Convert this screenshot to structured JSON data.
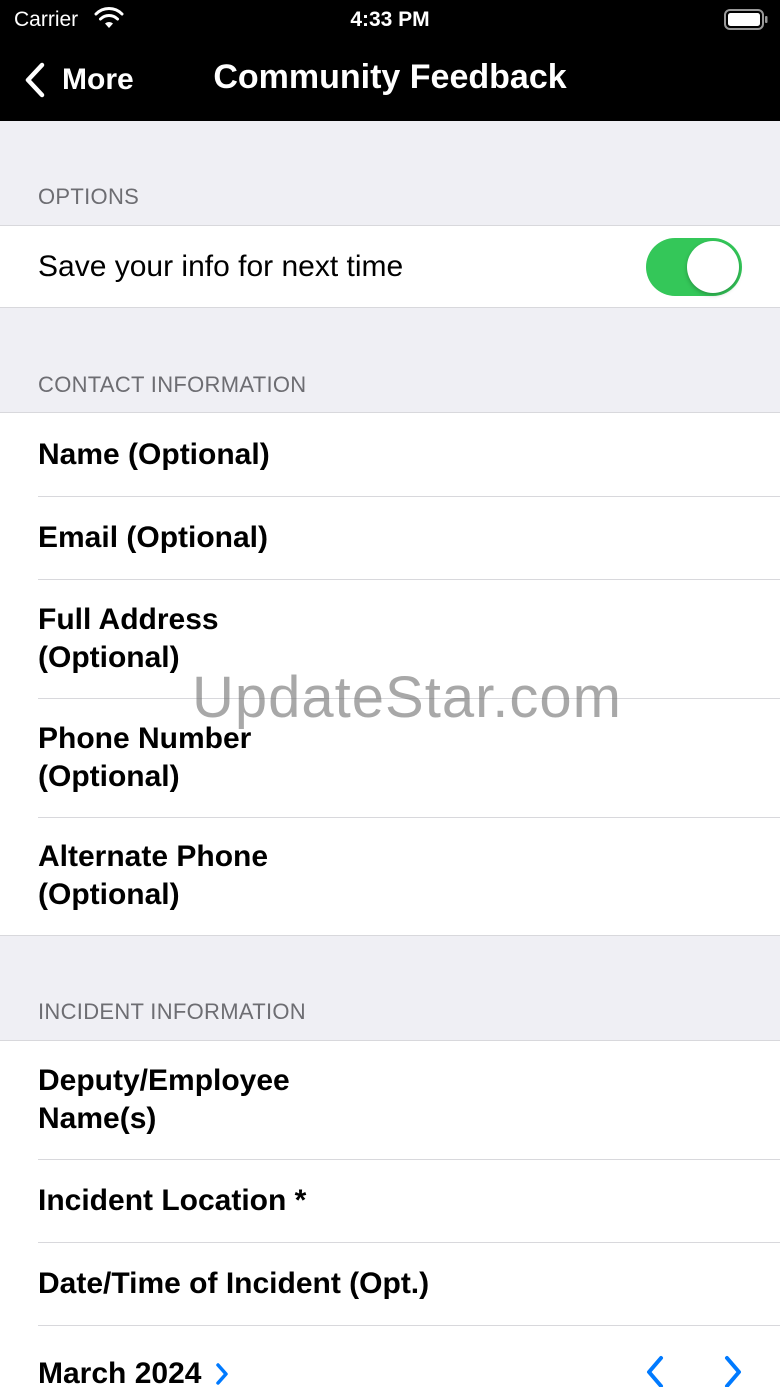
{
  "status_bar": {
    "carrier": "Carrier",
    "time": "4:33 PM"
  },
  "nav": {
    "back_label": "More",
    "title": "Community Feedback"
  },
  "sections": {
    "options": {
      "header": "OPTIONS",
      "save_info_label": "Save your info for next time",
      "save_info_on": true
    },
    "contact": {
      "header": "CONTACT INFORMATION",
      "fields": [
        {
          "label": "Name (Optional)"
        },
        {
          "label": "Email (Optional)"
        },
        {
          "label_line1": "Full Address",
          "label_line2": "(Optional)"
        },
        {
          "label_line1": "Phone Number",
          "label_line2": "(Optional)"
        },
        {
          "label_line1": "Alternate Phone",
          "label_line2": "(Optional)"
        }
      ]
    },
    "incident": {
      "header": "INCIDENT INFORMATION",
      "fields": [
        {
          "label_line1": "Deputy/Employee",
          "label_line2": "Name(s)"
        },
        {
          "label": "Incident Location *"
        },
        {
          "label": "Date/Time of Incident (Opt.)"
        }
      ],
      "calendar_month": "March 2024"
    }
  },
  "watermark": "UpdateStar.com",
  "colors": {
    "toggle_on": "#34c759",
    "accent": "#007aff",
    "bar_background": "#000000",
    "grouped_background": "#efeff4"
  }
}
